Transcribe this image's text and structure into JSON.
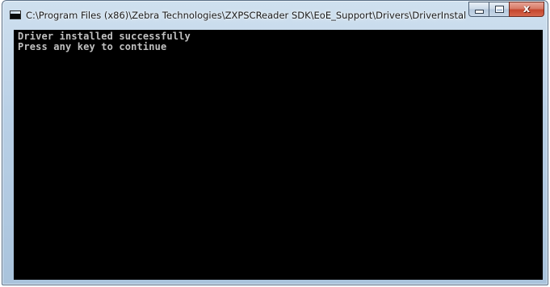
{
  "window": {
    "title": "C:\\Program Files (x86)\\Zebra Technologies\\ZXPSCReader SDK\\EoE_Support\\Drivers\\DriverInstal..."
  },
  "caption_buttons": {
    "minimize_icon": "minimize-icon",
    "maximize_icon": "maximize-icon",
    "close_icon": "close-icon",
    "close_glyph": "x"
  },
  "console": {
    "lines": [
      "Driver installed successfully",
      "Press any key to continue"
    ],
    "background": "#000000",
    "foreground": "#c0c0c0"
  }
}
